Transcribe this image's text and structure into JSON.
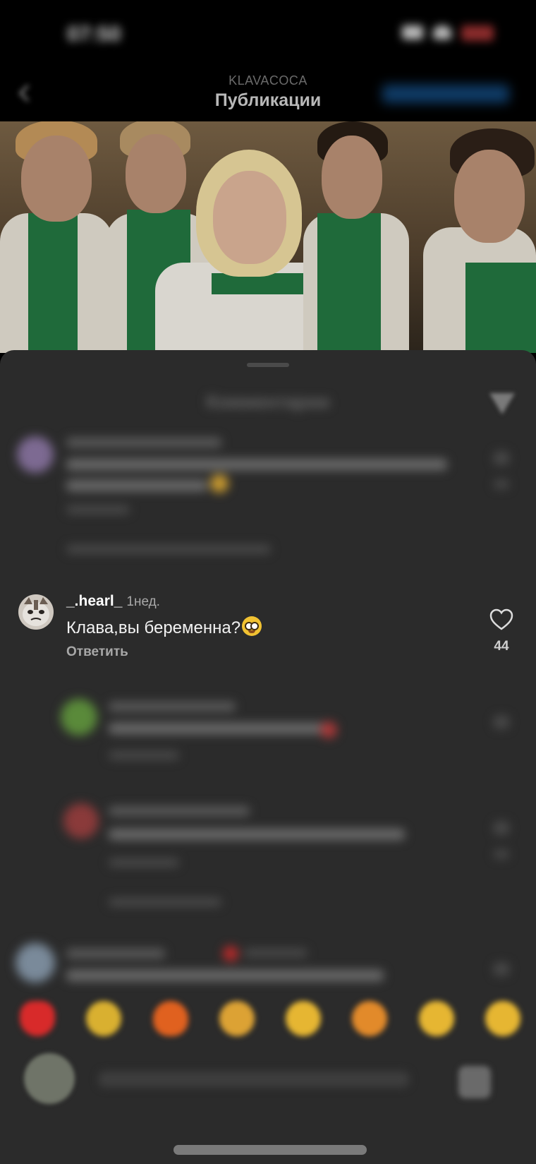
{
  "status_bar": {
    "time": "07:50"
  },
  "header": {
    "account": "KLAVACOCA",
    "title": "Публикации",
    "follow_label": "Подписаться"
  },
  "sheet": {
    "title": "Комментарии"
  },
  "comments": [
    {
      "username": "_.hearl_",
      "time": "1нед.",
      "text": "Клава,вы беременна?",
      "reply_label": "Ответить",
      "likes": "44"
    }
  ],
  "colors": {
    "sheet_background": "#2b2b2b",
    "text_primary": "#f2f2f2",
    "text_secondary": "#a8a8a8"
  },
  "icons": [
    "back-icon",
    "filter-icon",
    "heart-icon",
    "gif-icon"
  ]
}
